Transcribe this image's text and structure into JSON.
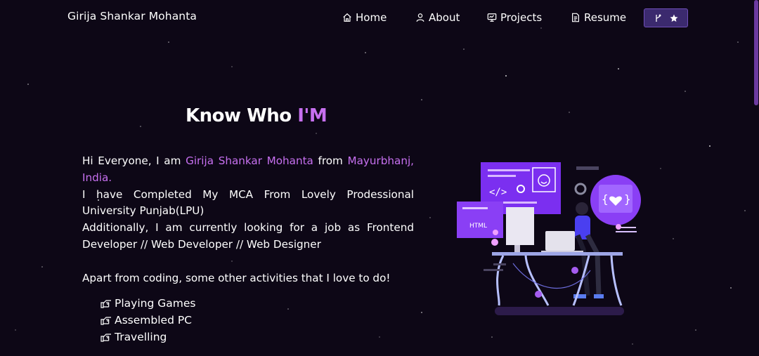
{
  "navbar": {
    "brand": "Girija Shankar Mohanta",
    "items": [
      {
        "label": "Home",
        "icon": "home-icon"
      },
      {
        "label": "About",
        "icon": "user-icon"
      },
      {
        "label": "Projects",
        "icon": "projects-icon"
      },
      {
        "label": "Resume",
        "icon": "document-icon"
      }
    ],
    "fork_button": {
      "icons": [
        "git-fork-icon",
        "star-icon"
      ]
    }
  },
  "heading": {
    "prefix": "Know Who ",
    "accent": "I'M"
  },
  "about": {
    "greeting": "Hi Everyone, I am ",
    "name": "Girija Shankar Mohanta",
    "from": " from ",
    "location": "Mayurbhanj, India.",
    "line2": "I have Completed My MCA From Lovely Prodessional University Punjab(LPU)",
    "line3": "Additionally, I am currently looking for a job as Frontend Developer // Web Developer // Web Designer",
    "line4": "Apart from coding, some other activities that I love to do!"
  },
  "activities": [
    "Playing Games",
    "Assembled PC",
    "Travelling"
  ],
  "colors": {
    "accent": "#c770f0",
    "background": "#0d0716",
    "button_bg": "#3b2a6e"
  }
}
